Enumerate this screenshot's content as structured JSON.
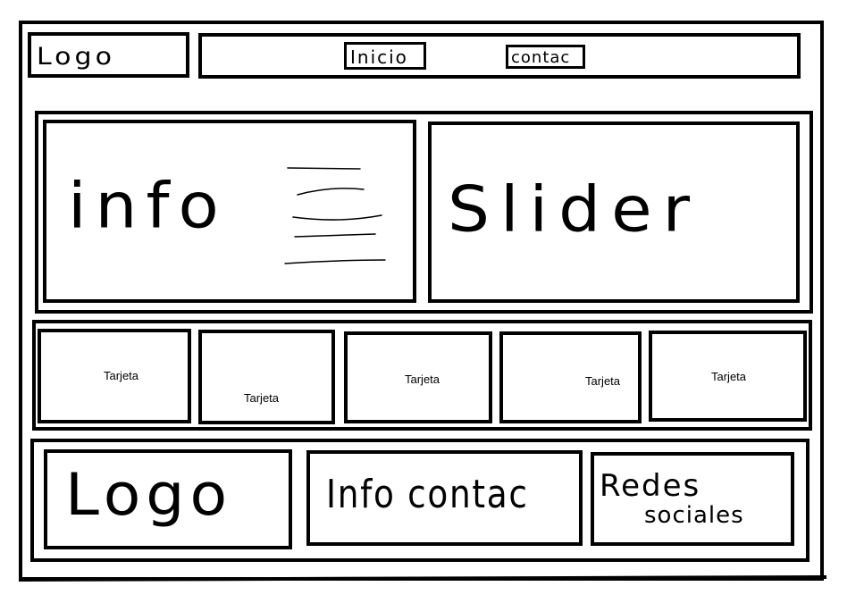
{
  "header": {
    "logo": "Logo",
    "nav": {
      "inicio": "Inicio",
      "contacto": "contac"
    }
  },
  "hero": {
    "info": "info",
    "slider": "Slider"
  },
  "cards": [
    "Tarjeta",
    "Tarjeta",
    "Tarjeta",
    "Tarjeta",
    "Tarjeta"
  ],
  "footer": {
    "logo": "Logo",
    "contact_info": "Info contac",
    "social_line1": "Redes",
    "social_line2": "sociales"
  }
}
